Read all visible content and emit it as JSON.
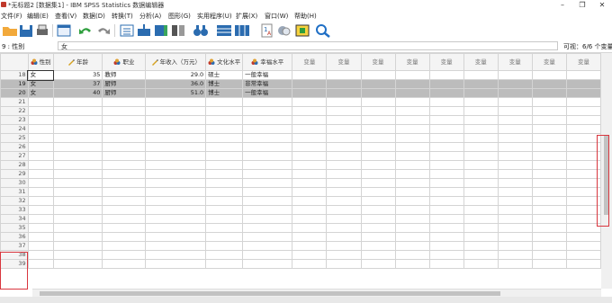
{
  "window": {
    "title": "*无标题2 [数据集1] - IBM SPSS Statistics 数据编辑器",
    "minimize": "–",
    "maximize": "❐",
    "close": "✕"
  },
  "menu": [
    "文件(F)",
    "编辑(E)",
    "查看(V)",
    "数据(D)",
    "转换(T)",
    "分析(A)",
    "图形(G)",
    "实用程序(U)",
    "扩展(X)",
    "窗口(W)",
    "帮助(H)"
  ],
  "cellbar": {
    "ref": "9 : 性别",
    "value": "女",
    "visible": "可视：6/6 个变量"
  },
  "columns": [
    {
      "label": "性别",
      "icon": "nominal-icon"
    },
    {
      "label": "年龄",
      "icon": "scale-icon"
    },
    {
      "label": "职业",
      "icon": "nominal-icon"
    },
    {
      "label": "年收入（万元）",
      "icon": "scale-icon"
    },
    {
      "label": "文化水平",
      "icon": "nominal-icon"
    },
    {
      "label": "幸福水平",
      "icon": "nominal-icon"
    },
    {
      "label": "变量"
    },
    {
      "label": "变量"
    },
    {
      "label": "变量"
    },
    {
      "label": "变量"
    },
    {
      "label": "变量"
    },
    {
      "label": "变量"
    },
    {
      "label": "变量"
    },
    {
      "label": "变量"
    },
    {
      "label": "变量"
    }
  ],
  "rows": [
    {
      "n": "18",
      "cells": [
        "女",
        "35",
        "教师",
        "29.0",
        "硕士",
        "一般幸福"
      ],
      "selected": false
    },
    {
      "n": "19",
      "cells": [
        "女",
        "37",
        "厨师",
        "36.0",
        "博士",
        "非常幸福"
      ],
      "selected": true
    },
    {
      "n": "20",
      "cells": [
        "女",
        "40",
        "厨师",
        "51.0",
        "博士",
        "一般幸福"
      ],
      "selected": true
    },
    {
      "n": "21",
      "cells": []
    },
    {
      "n": "22",
      "cells": []
    },
    {
      "n": "23",
      "cells": []
    },
    {
      "n": "24",
      "cells": []
    },
    {
      "n": "25",
      "cells": []
    },
    {
      "n": "26",
      "cells": []
    },
    {
      "n": "27",
      "cells": []
    },
    {
      "n": "28",
      "cells": []
    },
    {
      "n": "29",
      "cells": []
    },
    {
      "n": "30",
      "cells": []
    },
    {
      "n": "31",
      "cells": []
    },
    {
      "n": "32",
      "cells": []
    },
    {
      "n": "33",
      "cells": []
    },
    {
      "n": "34",
      "cells": []
    },
    {
      "n": "35",
      "cells": []
    },
    {
      "n": "36",
      "cells": []
    },
    {
      "n": "37",
      "cells": []
    },
    {
      "n": "38",
      "cells": []
    },
    {
      "n": "39",
      "cells": []
    }
  ],
  "colors": {
    "selected_row": "#bcbcbc",
    "highlight": "#d9363e"
  }
}
